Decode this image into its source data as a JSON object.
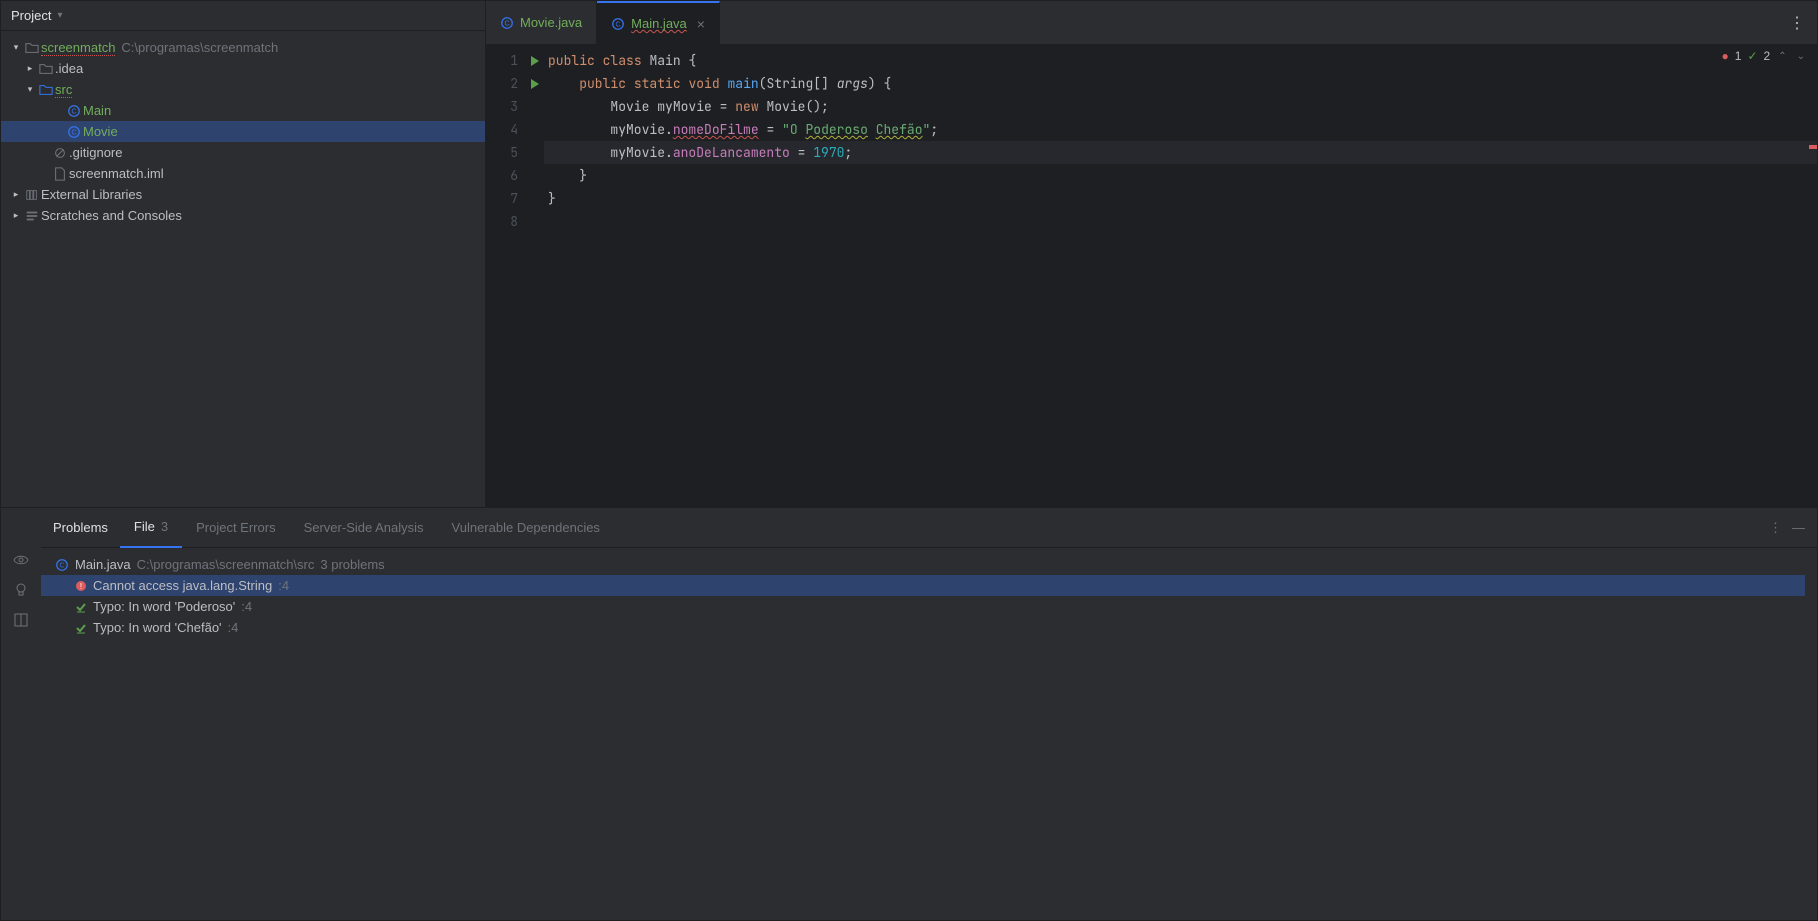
{
  "sidebar": {
    "title": "Project",
    "root": {
      "name": "screenmatch",
      "path": "C:\\programas\\screenmatch"
    },
    "idea": ".idea",
    "src": "src",
    "main": "Main",
    "movie": "Movie",
    "gitignore": ".gitignore",
    "iml": "screenmatch.iml",
    "extlib": "External Libraries",
    "scratches": "Scratches and Consoles"
  },
  "tabs": {
    "movie": "Movie.java",
    "main": "Main.java"
  },
  "indicators": {
    "errors": "1",
    "warnings": "2"
  },
  "code": {
    "l1": {
      "kw1": "public",
      "kw2": "class",
      "cls": "Main",
      "end": " {"
    },
    "l2": {
      "kw1": "public",
      "kw2": "static",
      "kw3": "void",
      "mth": "main",
      "p1": "(String[] ",
      "arg": "args",
      "p2": ") {"
    },
    "l3": {
      "cls": "Movie",
      "var": "myMovie",
      "eq": " = ",
      "kw": "new",
      "call": " Movie();"
    },
    "l4": {
      "var": "myMovie",
      "dot": ".",
      "field": "nomeDoFilme",
      "eq": " = ",
      "q1": "\"",
      "w1": "O ",
      "w2": "Poderoso",
      "sp": " ",
      "w3": "Chefão",
      "q2": "\"",
      "end": ";"
    },
    "l5": {
      "var": "myMovie",
      "dot": ".",
      "field": "anoDeLancamento",
      "eq": " = ",
      "num": "1970",
      "end": ";"
    },
    "l6": "    }",
    "l7": "}"
  },
  "problems": {
    "label": "Problems",
    "tabs": {
      "file": "File",
      "file_count": "3",
      "errors": "Project Errors",
      "server": "Server-Side Analysis",
      "vuln": "Vulnerable Dependencies"
    },
    "header": {
      "name": "Main.java",
      "path": "C:\\programas\\screenmatch\\src",
      "count": "3 problems"
    },
    "items": [
      {
        "msg": "Cannot access java.lang.String",
        "loc": ":4",
        "type": "error"
      },
      {
        "msg": "Typo: In word 'Poderoso'",
        "loc": ":4",
        "type": "typo"
      },
      {
        "msg": "Typo: In word 'Chefão'",
        "loc": ":4",
        "type": "typo"
      }
    ]
  }
}
